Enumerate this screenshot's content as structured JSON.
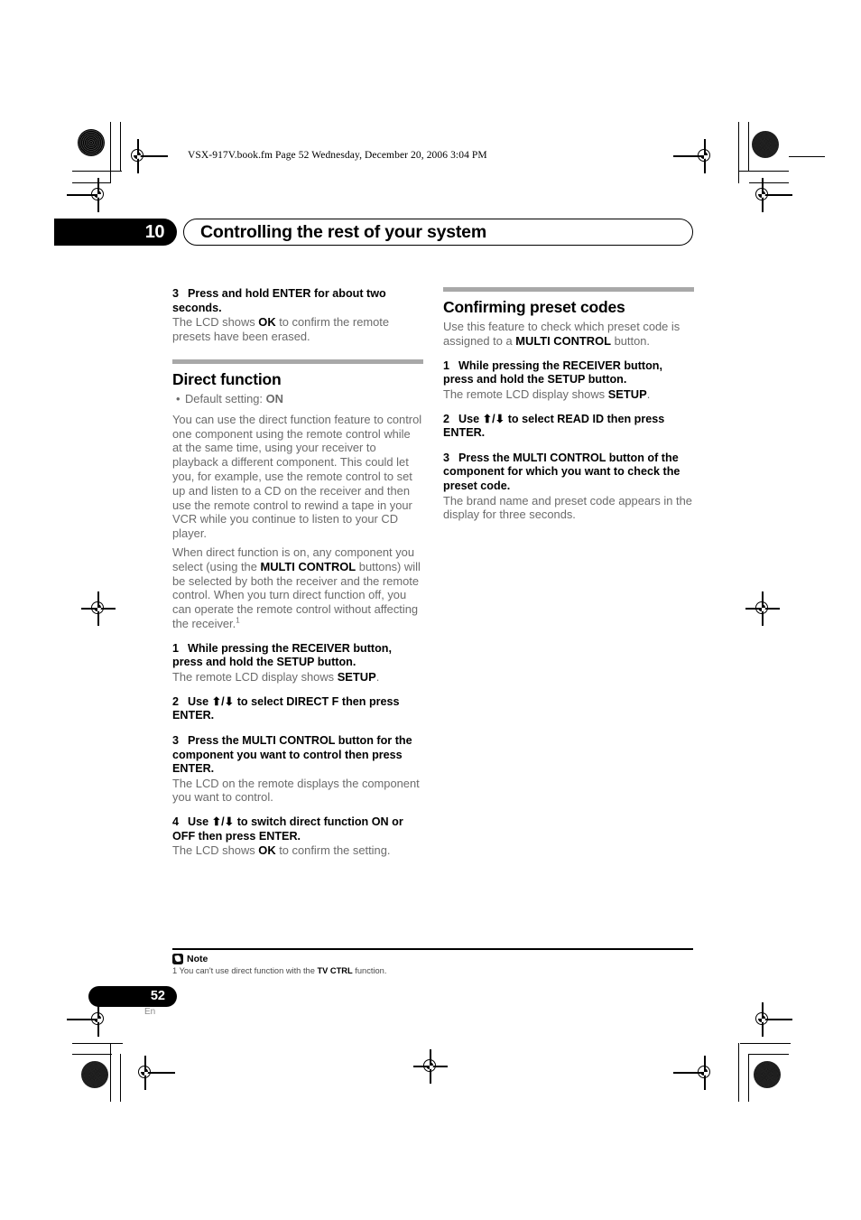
{
  "print_marks": {
    "filename_slug": "VSX-917V.book.fm  Page 52  Wednesday, December 20, 2006  3:04 PM"
  },
  "header": {
    "chapter_number": "10",
    "chapter_title": "Controlling the rest of your system"
  },
  "left_column": {
    "step3_erase": {
      "number": "3",
      "heading": "Press and hold ENTER for about two seconds.",
      "body_pre": "The LCD shows ",
      "body_bold": "OK",
      "body_post": " to confirm the remote presets have been erased."
    },
    "section": {
      "heading": "Direct function",
      "bullet_pre": "Default setting: ",
      "bullet_bold": "ON",
      "para1": "You can use the direct function feature to control one component using the remote control while at the same time, using your receiver to playback a different component. This could let you, for example, use the remote control to set up and listen to a CD on the receiver and then use the remote control to rewind a tape in your VCR while you continue to listen to your CD player.",
      "para2_a": "When direct function is on, any component you select (using the ",
      "para2_bold": "MULTI CONTROL",
      "para2_b": " buttons) will be selected by both the receiver and the remote control. When you turn direct function off, you can operate the remote control without affecting the receiver.",
      "para2_footnote_marker": "1"
    },
    "steps": [
      {
        "number": "1",
        "heading": "While pressing the RECEIVER button, press and hold the SETUP button.",
        "body_pre": "The remote LCD display shows ",
        "body_bold": "SETUP",
        "body_post": "."
      },
      {
        "number": "2",
        "heading_pre": "Use ",
        "heading_arrows": "⬆/⬇",
        "heading_post": " to select DIRECT F then press ENTER.",
        "body_pre": "",
        "body_bold": "",
        "body_post": ""
      },
      {
        "number": "3",
        "heading": "Press the MULTI CONTROL button for the component you want to control then press ENTER.",
        "body_pre": "The LCD on the remote displays the component you want to control.",
        "body_bold": "",
        "body_post": ""
      },
      {
        "number": "4",
        "heading_pre": "Use ",
        "heading_arrows": "⬆/⬇",
        "heading_post": " to switch direct function ON or OFF then press ENTER.",
        "body_pre": "The LCD shows ",
        "body_bold": "OK",
        "body_post": " to confirm the setting."
      }
    ]
  },
  "right_column": {
    "section": {
      "heading": "Confirming preset codes",
      "intro_a": "Use this feature to check which preset code is assigned to a ",
      "intro_bold": "MULTI CONTROL",
      "intro_b": " button."
    },
    "steps": [
      {
        "number": "1",
        "heading": "While pressing the RECEIVER button, press and hold the SETUP button.",
        "body_pre": "The remote LCD display shows ",
        "body_bold": "SETUP",
        "body_post": "."
      },
      {
        "number": "2",
        "heading_pre": "Use ",
        "heading_arrows": "⬆/⬇",
        "heading_post": " to select READ ID then press ENTER."
      },
      {
        "number": "3",
        "heading": "Press the MULTI CONTROL button of the component for which you want to check the preset code.",
        "body_pre": "The brand name and preset code appears in the display for three seconds.",
        "body_bold": "",
        "body_post": ""
      }
    ]
  },
  "note": {
    "label": "Note",
    "marker": "1",
    "text_a": " You can't use direct function with the ",
    "text_bold": "TV CTRL",
    "text_b": " function."
  },
  "footer": {
    "page_number": "52",
    "language": "En"
  },
  "colors": {
    "body_text": "#6b6b6b",
    "heading_text": "#000000",
    "section_rule": "#a8a8a8",
    "pill_fill": "#000000"
  }
}
